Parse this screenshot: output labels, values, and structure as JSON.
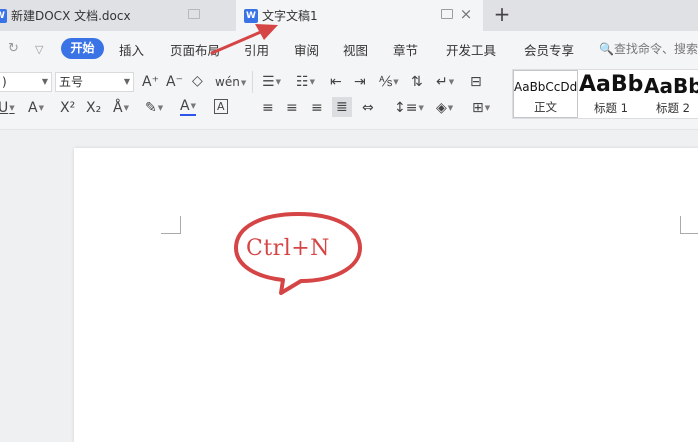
{
  "tabs": [
    {
      "label": "新建DOCX 文档.docx",
      "icon": "W",
      "active": false
    },
    {
      "label": "文字文稿1",
      "icon": "W",
      "active": true
    }
  ],
  "new_tab_label": "+",
  "menu": {
    "active": "开始",
    "items": [
      "插入",
      "页面布局",
      "引用",
      "审阅",
      "视图",
      "章节",
      "开发工具",
      "会员专享"
    ],
    "search_placeholder": "查找命令、搜索"
  },
  "toolbar": {
    "font_name": ")",
    "font_size": "五号",
    "font_grow": "A⁺",
    "font_shrink": "A⁻",
    "pinyin": "wén",
    "superscript": "X²",
    "subscript": "X₂",
    "font_color": "A",
    "char_border": "A"
  },
  "styles": [
    {
      "preview": "AaBbCcDd",
      "name": "正文"
    },
    {
      "preview": "AaBb",
      "name": "标题 1"
    },
    {
      "preview": "AaBb",
      "name": "标题 2"
    }
  ],
  "annotation": {
    "bubble_text": "Ctrl+N",
    "color": "#d64545"
  },
  "colors": {
    "accent": "#3a73e6",
    "tab_bar": "#dfe1e5",
    "ribbon": "#f4f5f7",
    "annotation_red": "#d64545"
  }
}
